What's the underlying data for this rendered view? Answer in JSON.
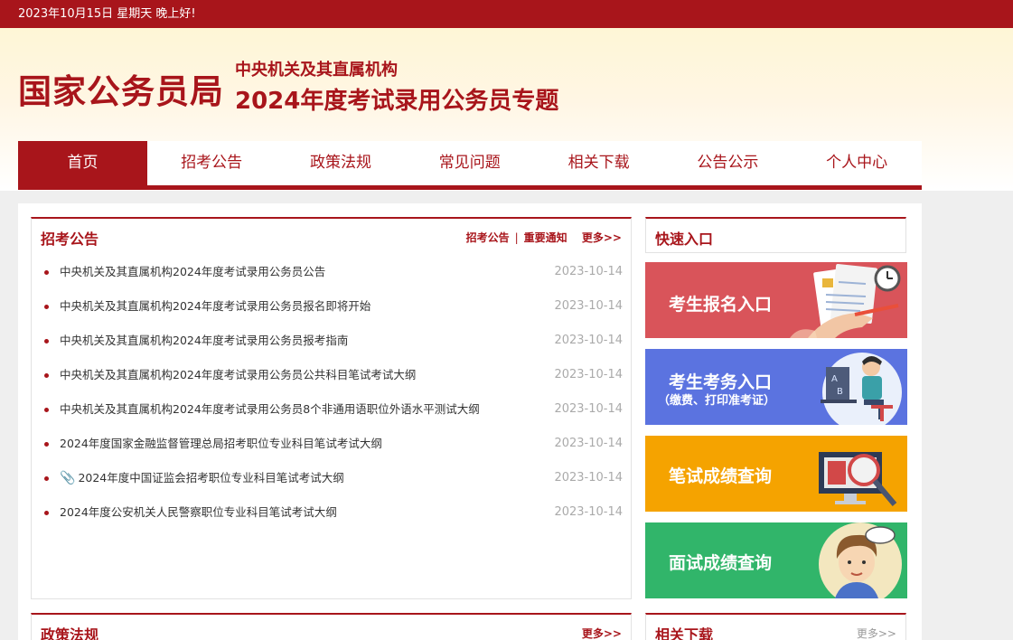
{
  "topbar": {
    "text": "2023年10月15日  星期天  晚上好!"
  },
  "header": {
    "site_title": "国家公务员局",
    "subtitle_1": "中央机关及其直属机构",
    "subtitle_2": "2024年度考试录用公务员专题"
  },
  "nav": {
    "items": [
      {
        "label": "首页",
        "active": true
      },
      {
        "label": "招考公告"
      },
      {
        "label": "政策法规"
      },
      {
        "label": "常见问题"
      },
      {
        "label": "相关下载"
      },
      {
        "label": "公告公示"
      },
      {
        "label": "个人中心"
      }
    ]
  },
  "announcements": {
    "title": "招考公告",
    "link_1": "招考公告",
    "separator": "|",
    "link_2": "重要通知",
    "more": "更多>>",
    "items": [
      {
        "title": "中央机关及其直属机构2024年度考试录用公务员公告",
        "date": "2023-10-14"
      },
      {
        "title": "中央机关及其直属机构2024年度考试录用公务员报名即将开始",
        "date": "2023-10-14"
      },
      {
        "title": "中央机关及其直属机构2024年度考试录用公务员报考指南",
        "date": "2023-10-14"
      },
      {
        "title": "中央机关及其直属机构2024年度考试录用公务员公共科目笔试考试大纲",
        "date": "2023-10-14"
      },
      {
        "title": "中央机关及其直属机构2024年度考试录用公务员8个非通用语职位外语水平测试大纲",
        "date": "2023-10-14"
      },
      {
        "title": "2024年度国家金融监督管理总局招考职位专业科目笔试考试大纲",
        "date": "2023-10-14"
      },
      {
        "title": "2024年度中国证监会招考职位专业科目笔试考试大纲",
        "date": "2023-10-14",
        "icon": "paperclip-icon"
      },
      {
        "title": "2024年度公安机关人民警察职位专业科目笔试考试大纲",
        "date": "2023-10-14"
      }
    ]
  },
  "quick": {
    "title": "快速入口",
    "buttons": [
      {
        "label": "考生报名入口",
        "sub": "",
        "color": "#d9545a",
        "icon": "form-pen-icon"
      },
      {
        "label": "考生考务入口",
        "sub": "（缴费、打印准考证）",
        "color": "#5b73e0",
        "icon": "student-computer-icon"
      },
      {
        "label": "笔试成绩查询",
        "sub": "",
        "color": "#f5a300",
        "icon": "magnifier-monitor-icon"
      },
      {
        "label": "面试成绩查询",
        "sub": "",
        "color": "#31b56a",
        "icon": "interview-person-icon"
      }
    ]
  },
  "policy": {
    "title": "政策法规",
    "more": "更多>>"
  },
  "downloads": {
    "title": "相关下载",
    "more": "更多>>"
  },
  "colors": {
    "brand_red": "#a8151b"
  }
}
